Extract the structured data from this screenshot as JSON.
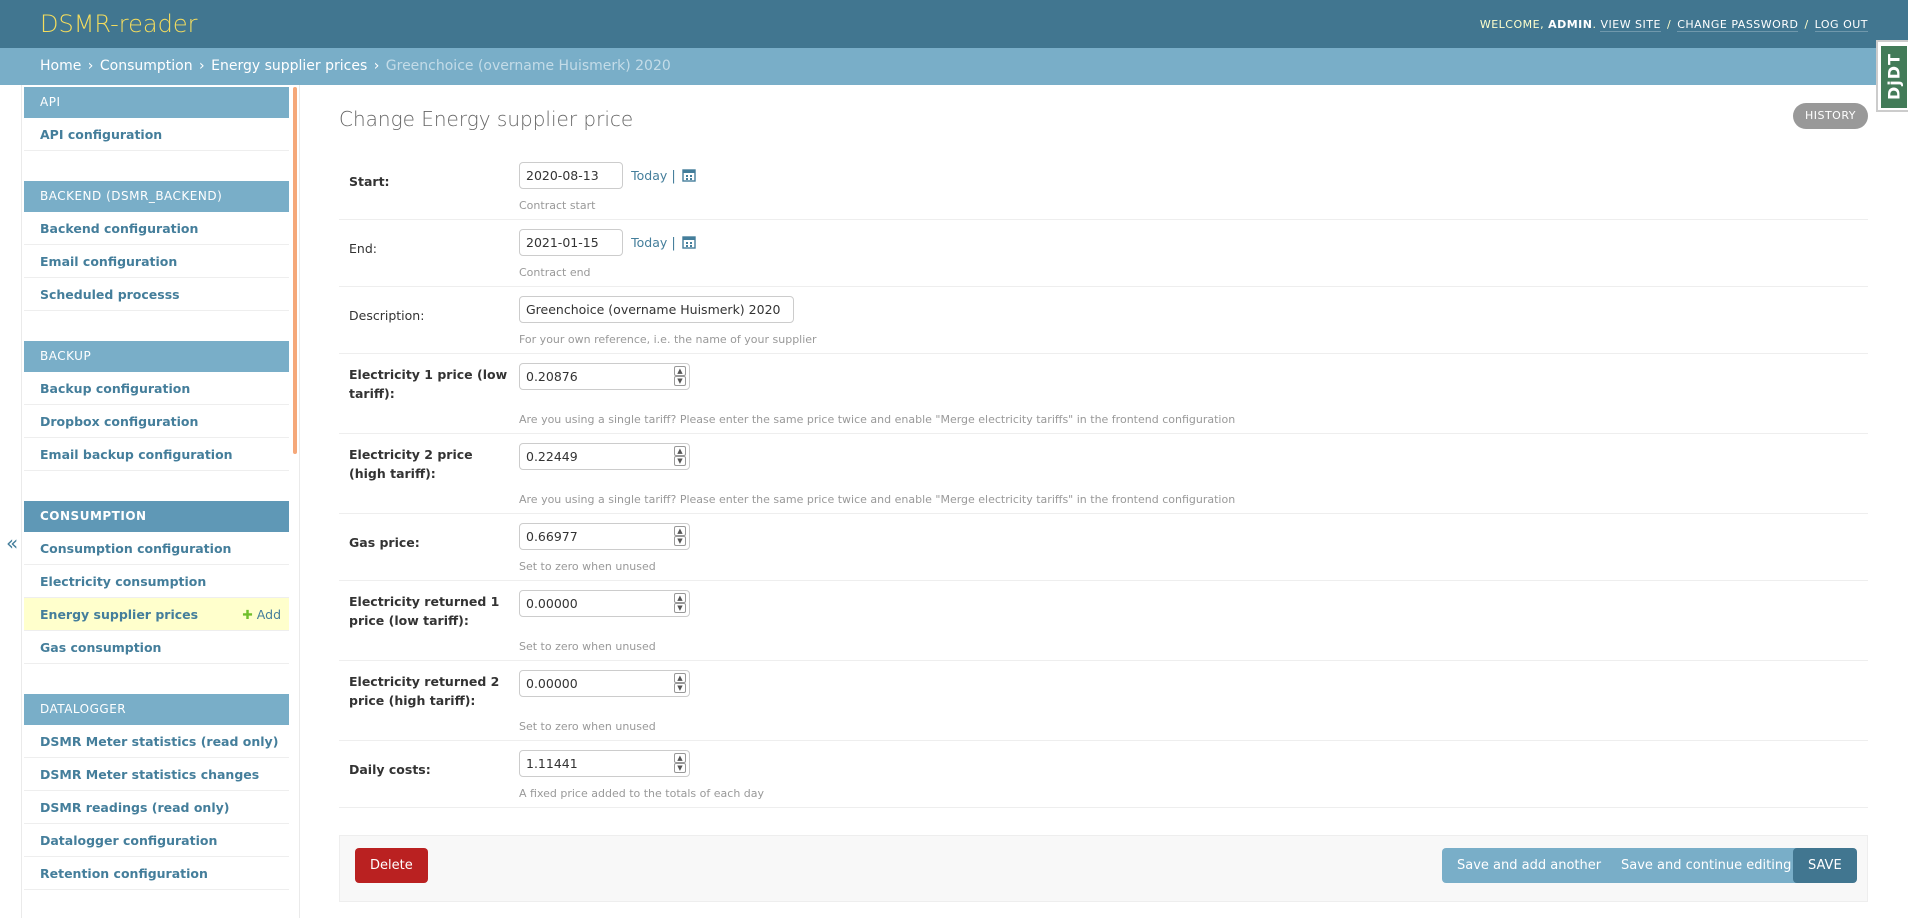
{
  "header": {
    "brand": "DSMR-reader",
    "welcome": "WELCOME,",
    "username": "ADMIN",
    "view_site": "VIEW SITE",
    "change_password": "CHANGE PASSWORD",
    "log_out": "LOG OUT"
  },
  "breadcrumbs": {
    "home": "Home",
    "consumption": "Consumption",
    "model": "Energy supplier prices",
    "current": "Greenchoice (overname Huismerk) 2020"
  },
  "djdt": "DjDT",
  "sidebar": {
    "toggle": "«",
    "modules": [
      {
        "caption": "API",
        "items": [
          "API configuration"
        ]
      },
      {
        "caption": "BACKEND (DSMR_BACKEND)",
        "items": [
          "Backend configuration",
          "Email configuration",
          "Scheduled processs"
        ]
      },
      {
        "caption": "BACKUP",
        "items": [
          "Backup configuration",
          "Dropbox configuration",
          "Email backup configuration"
        ]
      },
      {
        "caption": "CONSUMPTION",
        "items": [
          "Consumption configuration",
          "Electricity consumption",
          "Energy supplier prices",
          "Gas consumption"
        ]
      },
      {
        "caption": "DATALOGGER",
        "items": [
          "DSMR Meter statistics (read only)",
          "DSMR Meter statistics changes",
          "DSMR readings (read only)",
          "Datalogger configuration",
          "Retention configuration"
        ]
      }
    ],
    "add_label": "Add"
  },
  "content": {
    "title": "Change Energy supplier price",
    "history": "HISTORY",
    "fields": {
      "start": {
        "label": "Start:",
        "value": "2020-08-13",
        "today": "Today",
        "help": "Contract start"
      },
      "end": {
        "label": "End:",
        "value": "2021-01-15",
        "today": "Today",
        "help": "Contract end"
      },
      "description": {
        "label": "Description:",
        "value": "Greenchoice (overname Huismerk) 2020",
        "help": "For your own reference, i.e. the name of your supplier"
      },
      "e1": {
        "label": "Electricity 1 price (low tariff):",
        "value": "0.20876",
        "help": "Are you using a single tariff? Please enter the same price twice and enable \"Merge electricity tariffs\" in the frontend configuration"
      },
      "e2": {
        "label": "Electricity 2 price (high tariff):",
        "value": "0.22449",
        "help": "Are you using a single tariff? Please enter the same price twice and enable \"Merge electricity tariffs\" in the frontend configuration"
      },
      "gas": {
        "label": "Gas price:",
        "value": "0.66977",
        "help": "Set to zero when unused"
      },
      "r1": {
        "label": "Electricity returned 1 price (low tariff):",
        "value": "0.00000",
        "help": "Set to zero when unused"
      },
      "r2": {
        "label": "Electricity returned 2 price (high tariff):",
        "value": "0.00000",
        "help": "Set to zero when unused"
      },
      "daily": {
        "label": "Daily costs:",
        "value": "1.11441",
        "help": "A fixed price added to the totals of each day"
      }
    }
  },
  "submit": {
    "delete": "Delete",
    "save_add": "Save and add another",
    "save_continue": "Save and continue editing",
    "save": "SAVE"
  },
  "colors": {
    "header_bg": "#417690",
    "breadcrumb_bg": "#79aec8",
    "brand": "#f5dd5d",
    "link": "#447e9b",
    "delete": "#ba2121",
    "selected_row": "#ffffcc"
  }
}
